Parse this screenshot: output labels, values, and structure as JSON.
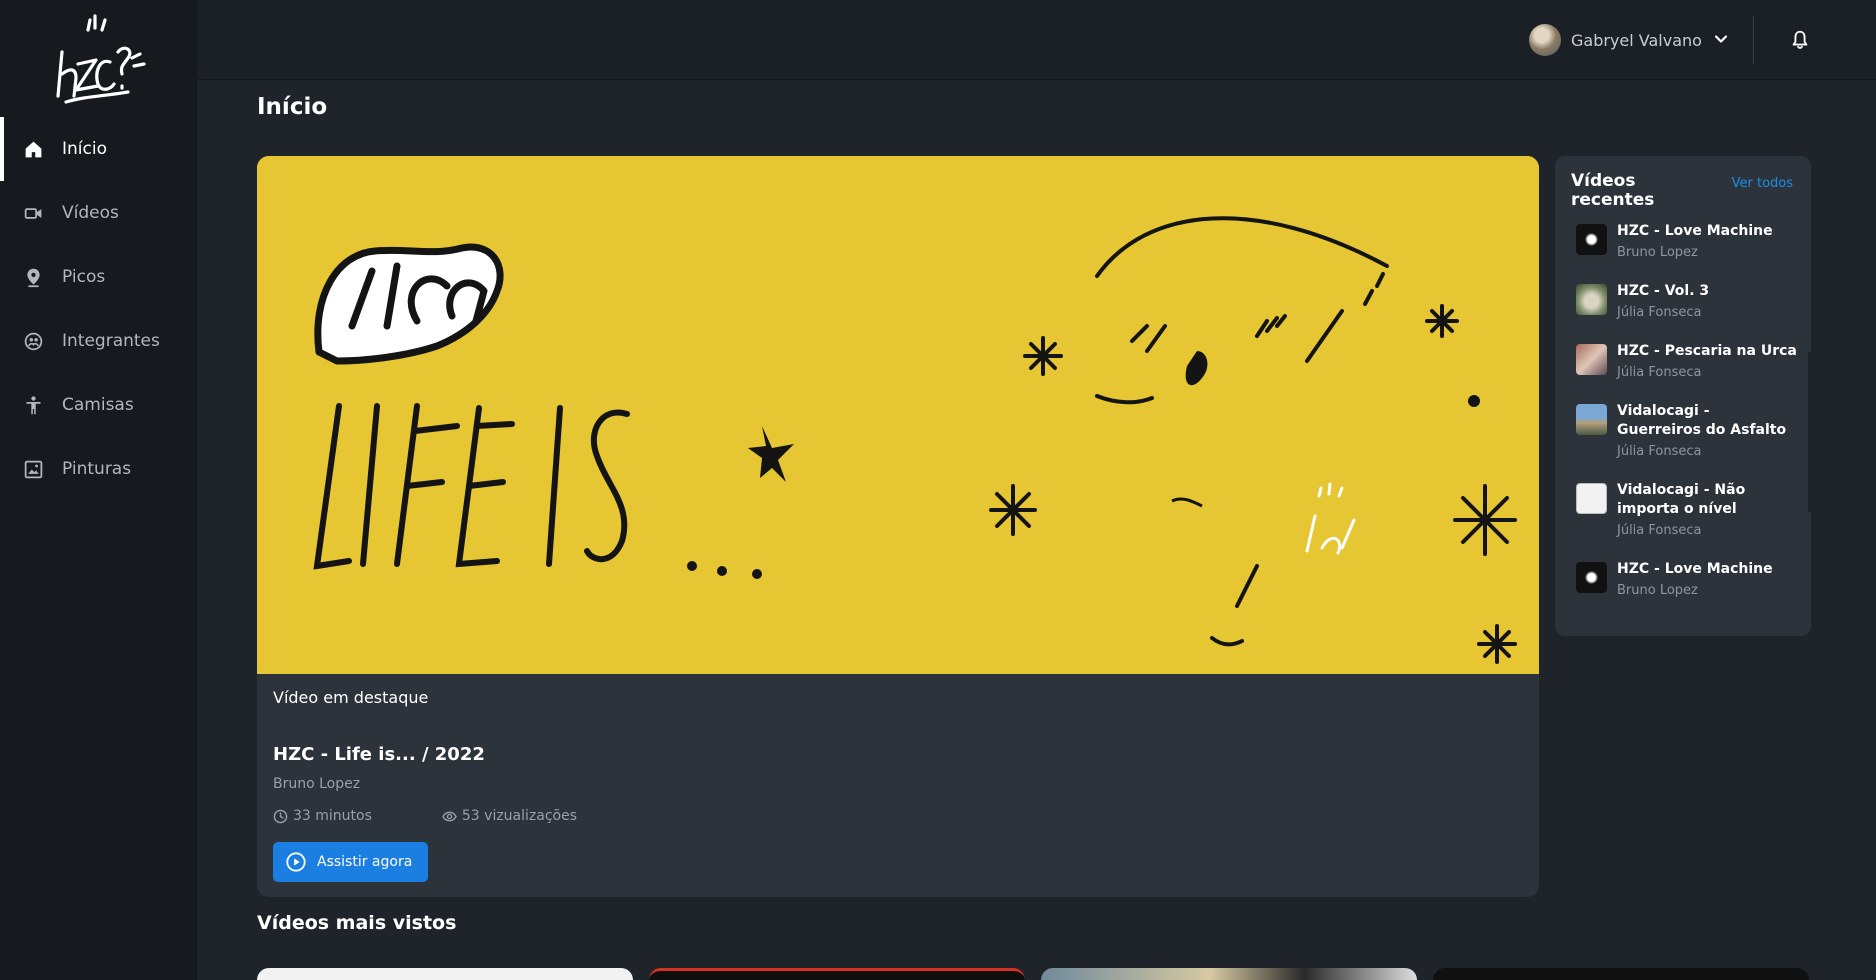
{
  "user": {
    "name": "Gabryel Valvano"
  },
  "nav": {
    "items": [
      {
        "label": "Início",
        "icon": "home-icon",
        "active": true
      },
      {
        "label": "Vídeos",
        "icon": "video-camera-icon",
        "active": false
      },
      {
        "label": "Picos",
        "icon": "map-pin-icon",
        "active": false
      },
      {
        "label": "Integrantes",
        "icon": "users-icon",
        "active": false
      },
      {
        "label": "Camisas",
        "icon": "person-icon",
        "active": false
      },
      {
        "label": "Pinturas",
        "icon": "painting-icon",
        "active": false
      }
    ]
  },
  "page": {
    "title": "Início"
  },
  "featured": {
    "label": "Vídeo em destaque",
    "title": "HZC - Life is... / 2022",
    "author": "Bruno Lopez",
    "duration": "33 minutos",
    "views": "53 vizualizações",
    "watch_label": "Assistir agora",
    "bg_color": "#e6c633"
  },
  "recent": {
    "title": "Vídeos recentes",
    "see_all": "Ver todos",
    "items": [
      {
        "name": "HZC - Love Machine",
        "author": "Bruno Lopez"
      },
      {
        "name": "HZC - Vol. 3",
        "author": "Júlia Fonseca"
      },
      {
        "name": "HZC - Pescaria na Urca",
        "author": "Júlia Fonseca"
      },
      {
        "name": "Vidalocagi - Guerreiros do Asfalto",
        "author": "Júlia Fonseca"
      },
      {
        "name": "Vidalocagi - Não importa o nível",
        "author": "Júlia Fonseca"
      },
      {
        "name": "HZC - Love Machine",
        "author": "Bruno Lopez"
      }
    ]
  },
  "most_viewed": {
    "title": "Vídeos mais vistos"
  },
  "colors": {
    "accent": "#1a7fe0",
    "link": "#1a8fe8",
    "panel": "#2d333b",
    "sidebar": "#161a1f"
  }
}
